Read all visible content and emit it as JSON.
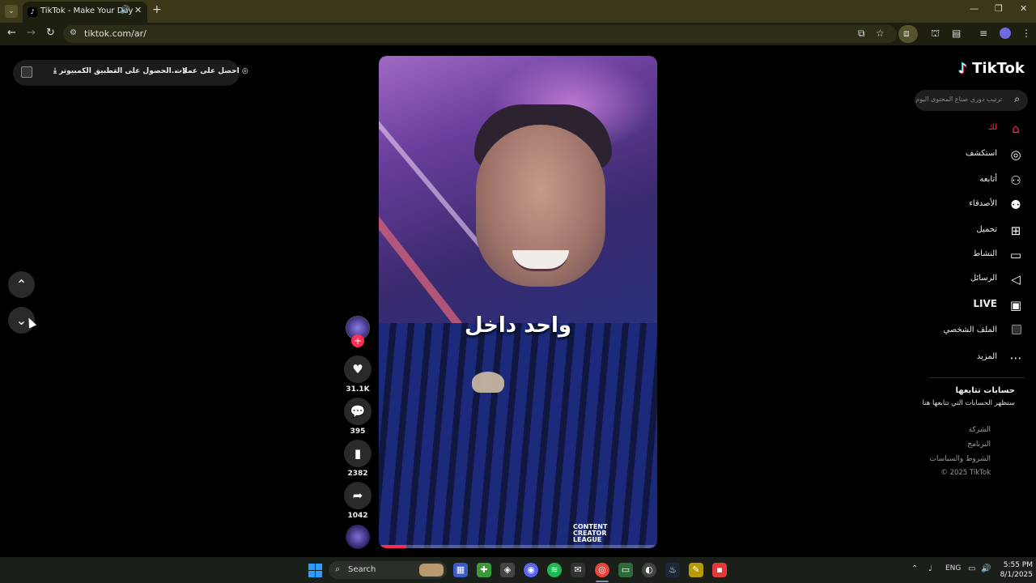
{
  "browser": {
    "tab_title": "TikTok - Make Your Day",
    "tab_favicon": "tiktok-logo-icon",
    "url": "tiktok.com/ar/"
  },
  "top_bar": {
    "get_coins": "احصل على عملات",
    "get_app": "الحصول على التـ...",
    "desktop_app": "تطبيق الكمبيوتر"
  },
  "video": {
    "caption": "واحد داخل",
    "watermark_line1": "CONTENT",
    "watermark_line2": "CREATOR",
    "watermark_line3": "LEAGUE",
    "progress": 0.1,
    "accent_color": "#fe2c55"
  },
  "actions": {
    "likes": "31.1K",
    "comments": "395",
    "saves": "2382",
    "shares": "1042"
  },
  "sidebar": {
    "logo": "TikTok",
    "search_placeholder": "ترتيب دوري صناع المحتوى اليوم",
    "items": [
      {
        "label": "لك",
        "icon": "home-icon",
        "active": true
      },
      {
        "label": "استكشف",
        "icon": "compass-icon"
      },
      {
        "label": "أتابعه",
        "icon": "user-follow-icon"
      },
      {
        "label": "الأصدقاء",
        "icon": "friends-icon"
      },
      {
        "label": "تحميل",
        "icon": "upload-icon"
      },
      {
        "label": "النشاط",
        "icon": "activity-icon"
      },
      {
        "label": "الرسائل",
        "icon": "messages-icon"
      },
      {
        "label": "LIVE",
        "icon": "live-icon"
      },
      {
        "label": "الملف الشخصي",
        "icon": "profile-image-icon"
      },
      {
        "label": "المزيد",
        "icon": "more-icon"
      }
    ],
    "following_title": "حسابات تتابعها",
    "following_subtitle": "ستظهر الحسابات التي تتابعها هنا",
    "footer_links": [
      "الشركة",
      "البرنامج",
      "الشروط والسياسات"
    ],
    "copyright": "© 2025 TikTok"
  },
  "taskbar": {
    "search_label": "Search",
    "language": "ENG",
    "time": "5:55 PM",
    "date": "8/1/2025"
  }
}
